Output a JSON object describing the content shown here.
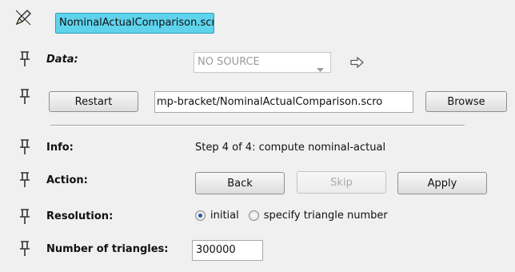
{
  "title_field": {
    "value": "NominalActualComparison.scro",
    "color": "#5fd3ec"
  },
  "data": {
    "label": "Data:",
    "source_value": "NO SOURCE"
  },
  "file": {
    "restart_label": "Restart",
    "path_value": "mp-bracket/NominalActualComparison.scro",
    "browse_label": "Browse"
  },
  "info": {
    "label": "Info:",
    "value": "Step 4 of 4: compute nominal-actual"
  },
  "action": {
    "label": "Action:",
    "back_label": "Back",
    "skip_label": "Skip",
    "apply_label": "Apply"
  },
  "resolution": {
    "label": "Resolution:",
    "options": [
      {
        "label": "initial",
        "selected": true
      },
      {
        "label": "specify triangle number",
        "selected": false
      }
    ]
  },
  "triangles": {
    "label": "Number of triangles:",
    "value": "300000"
  },
  "icons": [
    "pencil-icon",
    "pin-icon",
    "dropdown-arrow-icon",
    "arrow-right-icon"
  ]
}
